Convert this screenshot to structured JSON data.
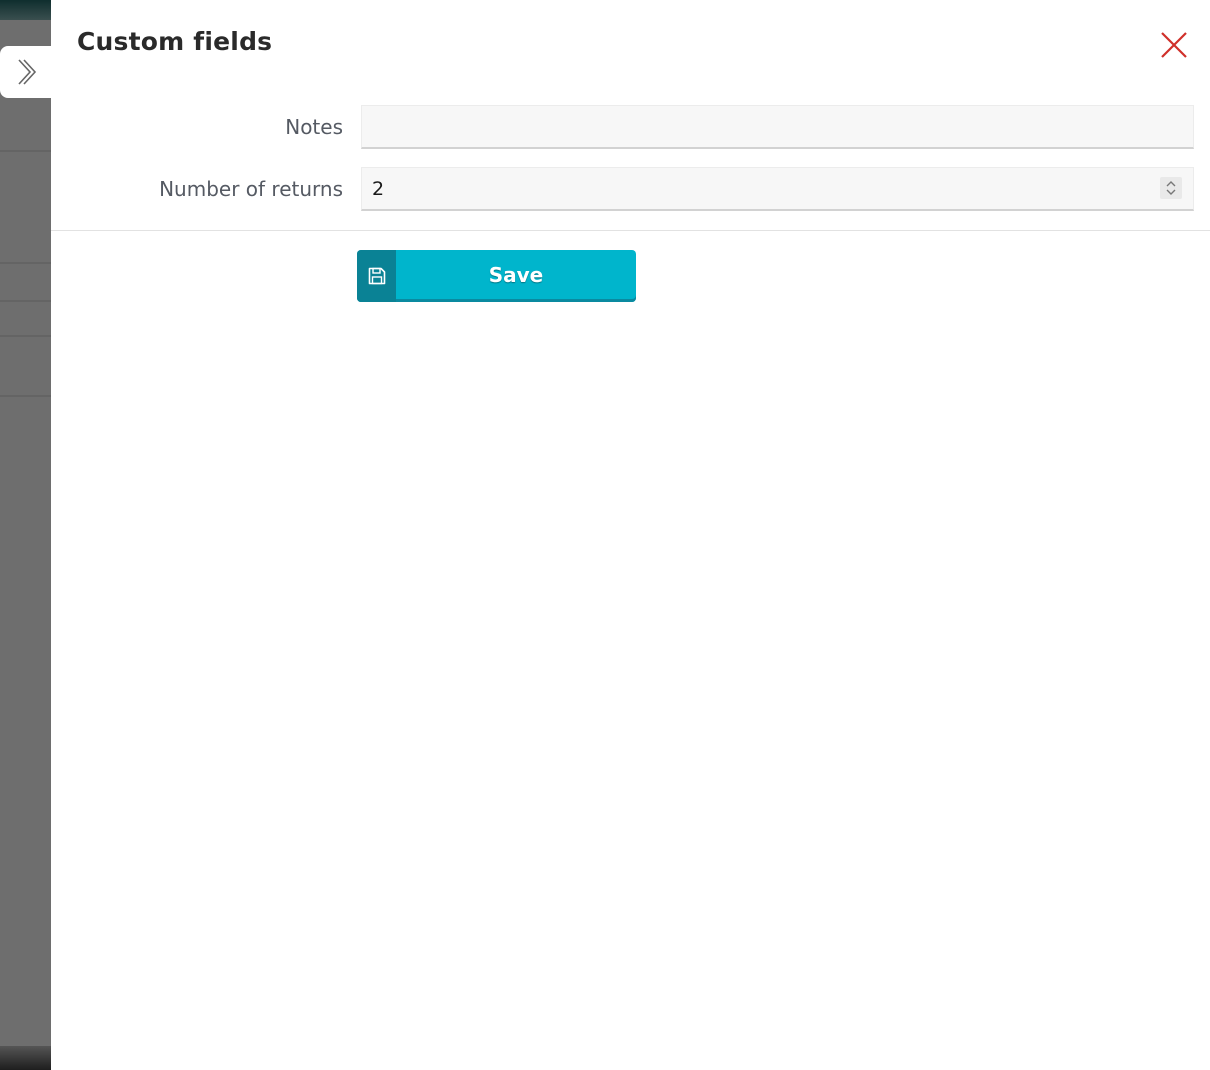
{
  "panel": {
    "title": "Custom fields"
  },
  "fields": {
    "notes": {
      "label": "Notes",
      "value": "",
      "placeholder": ""
    },
    "returns": {
      "label": "Number of returns",
      "value": "2"
    }
  },
  "actions": {
    "save_label": "Save"
  },
  "icons": {
    "collapse": "chevron-right-icon",
    "close": "close-icon",
    "save": "floppy-disk-icon",
    "spinner": "up-down-icon"
  },
  "colors": {
    "accent": "#00b5cc",
    "accent_dark": "#0a8295",
    "close": "#d0302a"
  }
}
